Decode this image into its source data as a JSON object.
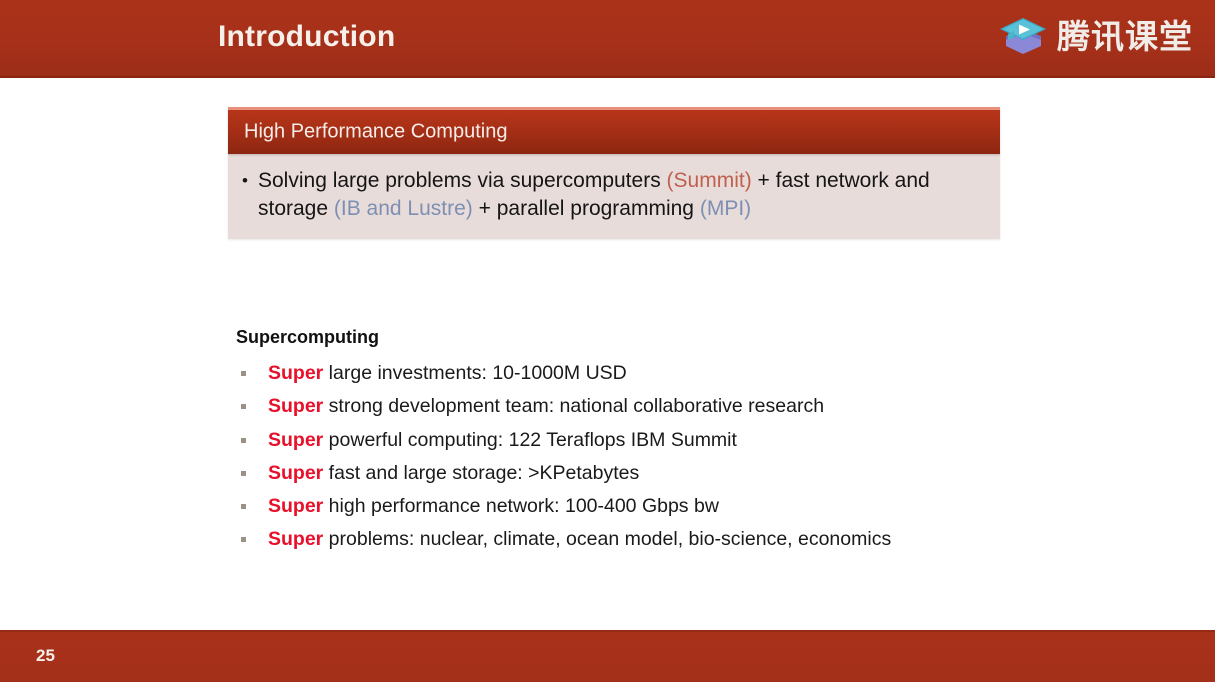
{
  "slide": {
    "header": {
      "title": "Introduction",
      "background_color": "#a7301a",
      "title_color": "#f7efe9"
    },
    "logo": {
      "icon_name": "graduation-cap-play-icon",
      "text": "腾讯课堂",
      "cap_top_color": "#49b6cf",
      "cap_body_color": "#7f7fd0",
      "play_color": "#ffffff"
    },
    "callout": {
      "heading": "High Performance Computing",
      "heading_bg_color": "#a62f16",
      "body_bg_color": "#e8dcda",
      "bullet": {
        "segments": [
          {
            "text": "Solving large problems via supercomputers ",
            "style": "plain"
          },
          {
            "text": "(Summit)",
            "style": "red"
          },
          {
            "text": " + fast network and storage ",
            "style": "plain"
          },
          {
            "text": "(IB and Lustre)",
            "style": "blue"
          },
          {
            "text": " + parallel programming ",
            "style": "plain"
          },
          {
            "text": "(MPI)",
            "style": "blue"
          }
        ]
      }
    },
    "supercomputing": {
      "heading": "Supercomputing",
      "emphasis_color": "#e8102a",
      "items": [
        {
          "strong": "Super",
          "rest": " large investments: 10-1000M USD"
        },
        {
          "strong": "Super",
          "rest": " strong development team: national collaborative research"
        },
        {
          "strong": "Super",
          "rest": " powerful computing: 122 Teraflops IBM Summit"
        },
        {
          "strong": "Super",
          "rest": " fast and large storage: >KPetabytes"
        },
        {
          "strong": "Super",
          "rest": " high performance network: 100-400 Gbps bw"
        },
        {
          "strong": "Super",
          "rest": " problems: nuclear, climate, ocean model, bio-science, economics"
        }
      ]
    },
    "footer": {
      "page_number": "25",
      "background_color": "#a7301a"
    }
  }
}
